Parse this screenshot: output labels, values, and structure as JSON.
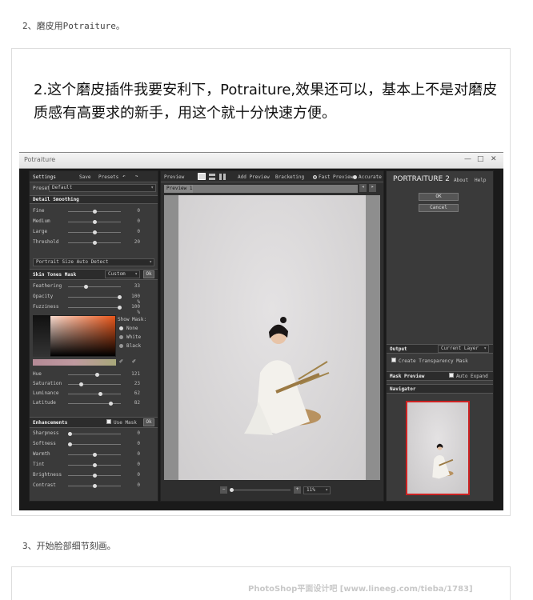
{
  "article": {
    "step2": "2、磨皮用Potraiture。",
    "headline": "2.这个磨皮插件我要安利下，Potraiture,效果还可以，基本上不是对磨皮质感有高要求的新手，用这个就十分快速方便。",
    "step3": "3、开始脸部细节刻画。",
    "watermark": "PhotoShop平面设计吧 [www.lineeg.com/tieba/1783]"
  },
  "window": {
    "title": "Potraiture"
  },
  "settings": {
    "title": "Settings",
    "save": "Save",
    "presets": "Presets",
    "preset_label": "Preset",
    "preset_value": "Default",
    "detail_header": "Detail Smoothing",
    "sliders": [
      {
        "label": "Fine",
        "value": "0",
        "pos": 0.5
      },
      {
        "label": "Medium",
        "value": "0",
        "pos": 0.5
      },
      {
        "label": "Large",
        "value": "0",
        "pos": 0.5
      },
      {
        "label": "Threshold",
        "value": "20",
        "pos": 0.5
      }
    ],
    "portrait_size": "Portrait Size Auto Detect",
    "skin_header": "Skin Tones Mask",
    "skin_mode": "Custom",
    "ok": "Ok",
    "skin_sliders": [
      {
        "label": "Feathering",
        "value": "33",
        "pos": 0.33
      },
      {
        "label": "Opacity",
        "value": "100 %",
        "pos": 1.0
      },
      {
        "label": "Fuzziness",
        "value": "100 %",
        "pos": 1.0
      }
    ],
    "show_mask_label": "Show Mask:",
    "show_mask_options": [
      "None",
      "White",
      "Black"
    ],
    "color_sliders": [
      {
        "label": "Hue",
        "value": "121",
        "pos": 0.55
      },
      {
        "label": "Saturation",
        "value": "23",
        "pos": 0.23
      },
      {
        "label": "Luminance",
        "value": "62",
        "pos": 0.62
      },
      {
        "label": "Latitude",
        "value": "82",
        "pos": 0.82
      }
    ],
    "enh_header": "Enhancements",
    "use_mask": "Use Mask",
    "enh_sliders": [
      {
        "label": "Sharpness",
        "value": "0",
        "pos": 0.0
      },
      {
        "label": "Softness",
        "value": "0",
        "pos": 0.0
      },
      {
        "label": "Warmth",
        "value": "0",
        "pos": 0.5
      },
      {
        "label": "Tint",
        "value": "0",
        "pos": 0.5
      },
      {
        "label": "Brightness",
        "value": "0",
        "pos": 0.5
      },
      {
        "label": "Contrast",
        "value": "0",
        "pos": 0.5
      }
    ]
  },
  "preview": {
    "title": "Preview",
    "add_preview": "Add Preview",
    "bracketing": "Bracketing",
    "fast_preview": "Fast Preview",
    "accurate": "Accurate",
    "tab": "Preview 1",
    "zoom": "11%"
  },
  "right": {
    "logo": "PORTRAITURE 2",
    "about": "About",
    "help": "Help",
    "ok": "OK",
    "cancel": "Cancel",
    "output_label": "Output",
    "output_value": "Current Layer",
    "create_mask": "Create Transparency Mask",
    "mask_preview": "Mask Preview",
    "auto_expand": "Auto Expand",
    "navigator": "Navigator"
  },
  "colors": {
    "accent": "#cc2222",
    "panel": "#3a3a3a",
    "photo_bg": "#d9d7d8"
  }
}
